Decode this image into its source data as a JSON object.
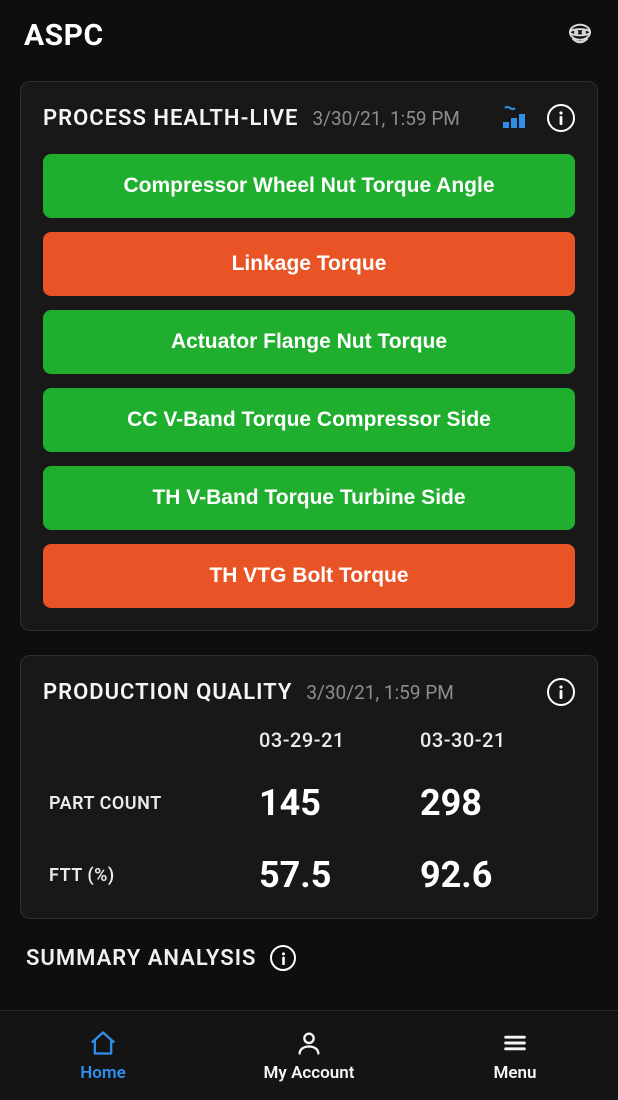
{
  "app_title": "ASPC",
  "process_health": {
    "title": "PROCESS HEALTH-LIVE",
    "timestamp": "3/30/21, 1:59 PM",
    "items": [
      {
        "label": "Compressor Wheel Nut Torque Angle",
        "status": "green"
      },
      {
        "label": "Linkage Torque",
        "status": "orange"
      },
      {
        "label": "Actuator Flange Nut Torque",
        "status": "green"
      },
      {
        "label": "CC V-Band Torque Compressor Side",
        "status": "green"
      },
      {
        "label": "TH V-Band Torque Turbine Side",
        "status": "green"
      },
      {
        "label": "TH VTG Bolt Torque",
        "status": "orange"
      }
    ]
  },
  "production_quality": {
    "title": "PRODUCTION QUALITY",
    "timestamp": "3/30/21, 1:59 PM",
    "columns": [
      "03-29-21",
      "03-30-21"
    ],
    "rows": [
      {
        "label": "PART COUNT",
        "values": [
          "145",
          "298"
        ]
      },
      {
        "label": "FTT (%)",
        "values": [
          "57.5",
          "92.6"
        ]
      }
    ]
  },
  "summary": {
    "title": "SUMMARY ANALYSIS"
  },
  "nav": {
    "home": "Home",
    "account": "My Account",
    "menu": "Menu",
    "active": "home"
  },
  "colors": {
    "green": "#1fae2e",
    "orange": "#e95427",
    "accent": "#2f8eea",
    "bg": "#0e0e0e",
    "card": "#181818"
  }
}
